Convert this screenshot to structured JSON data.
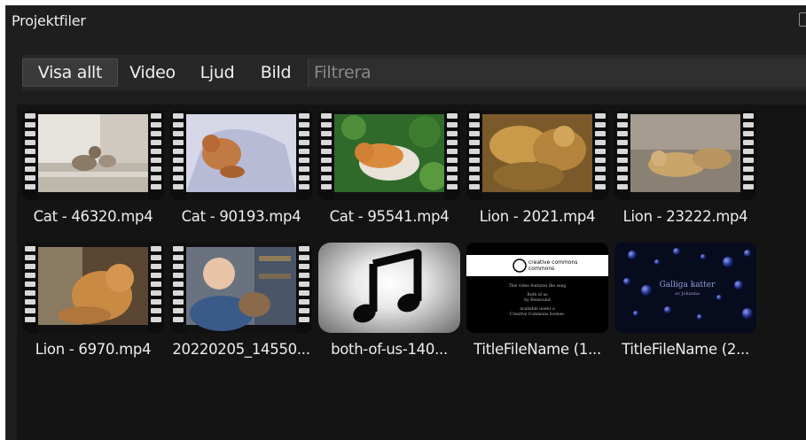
{
  "panel": {
    "title": "Projektfiler"
  },
  "filters": {
    "tabs": [
      {
        "label": "Visa allt",
        "active": true
      },
      {
        "label": "Video",
        "active": false
      },
      {
        "label": "Ljud",
        "active": false
      },
      {
        "label": "Bild",
        "active": false
      }
    ],
    "search_placeholder": "Filtrera"
  },
  "files": [
    {
      "name": "Cat - 46320.mp4",
      "kind": "video"
    },
    {
      "name": "Cat - 90193.mp4",
      "kind": "video"
    },
    {
      "name": "Cat - 95541.mp4",
      "kind": "video"
    },
    {
      "name": "Lion - 2021.mp4",
      "kind": "video"
    },
    {
      "name": "Lion - 23222.mp4",
      "kind": "video"
    },
    {
      "name": "Lion - 6970.mp4",
      "kind": "video"
    },
    {
      "name": "20220205_14550...",
      "kind": "video"
    },
    {
      "name": "both-of-us-140...",
      "kind": "audio"
    },
    {
      "name": "TitleFileName (1...",
      "kind": "title"
    },
    {
      "name": "TitleFileName (2...",
      "kind": "title"
    }
  ],
  "title_cards": {
    "first": {
      "logo": "creative commons",
      "lines": [
        "This video features the song",
        "Both of us",
        "by Bensound",
        "available under a",
        "Creative Commons license."
      ]
    },
    "second": {
      "heading": "Galliga katter",
      "byline": "av Johanna"
    }
  },
  "colors": {
    "panel_bg": "#1e1e1e",
    "grid_bg": "#141414",
    "filterbar_bg": "#272727",
    "title_navy": "#0a0f2a"
  }
}
